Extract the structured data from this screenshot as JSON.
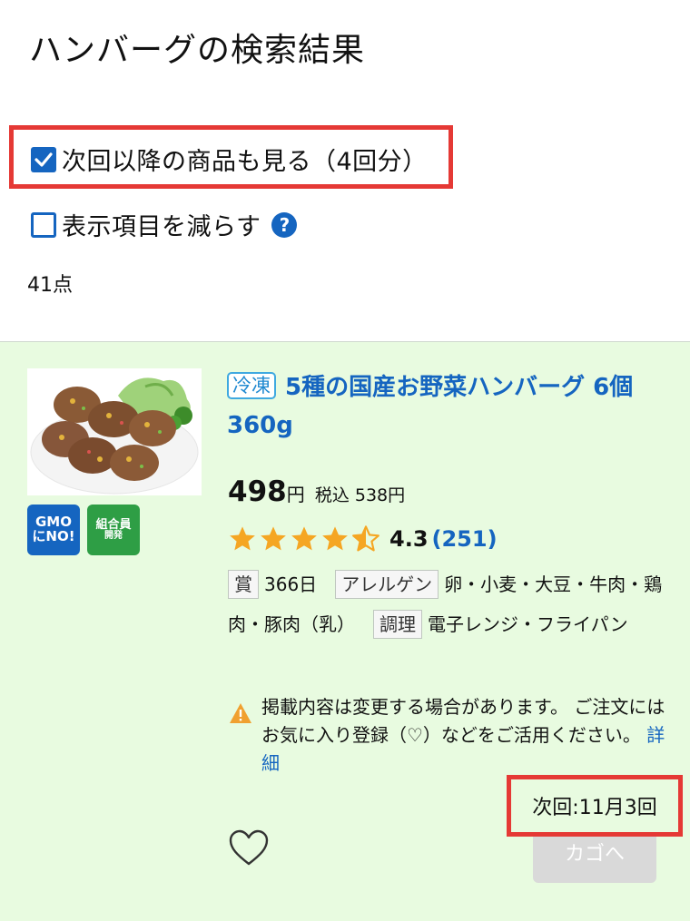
{
  "page": {
    "title": "ハンバーグの検索結果"
  },
  "filters": {
    "show_next": {
      "label": "次回以降の商品も見る（4回分）",
      "checked": true
    },
    "reduce_items": {
      "label": "表示項目を減らす",
      "checked": false
    },
    "help_icon": "?"
  },
  "results": {
    "count": "41点"
  },
  "product": {
    "tag": "冷凍",
    "name": "5種の国産お野菜ハンバーグ 6個360g",
    "badges": {
      "gmo_line1": "GMO",
      "gmo_line2": "にNO!",
      "kumiai_line1": "組合員",
      "kumiai_line2": "開発"
    },
    "price": "498",
    "price_unit": "円",
    "tax_label": "税込 538円",
    "rating": {
      "value": "4.3",
      "reviews": "(251)",
      "stars": 4.5
    },
    "info": {
      "award_chip": "賞",
      "award_days": "366日",
      "allergen_chip": "アレルゲン",
      "allergen_text": "卵・小麦・大豆・牛肉・鶏肉・豚肉（乳）",
      "cook_chip": "調理",
      "cook_text": "電子レンジ・フライパン"
    },
    "notice": "掲載内容は変更する場合があります。 ご注文にはお気に入り登録（♡）などをご活用ください。",
    "detail_link": "詳細",
    "next_delivery": "次回:11月3回",
    "cart_button": "カゴへ"
  },
  "colors": {
    "accent": "#1565c0",
    "highlight": "#e53935",
    "card_bg": "#e8fbe0",
    "star": "#f5a623"
  },
  "icons": {
    "checkbox": "checkbox-icon",
    "help": "question-icon",
    "star": "star-icon",
    "warning": "warning-icon",
    "heart": "heart-icon"
  }
}
